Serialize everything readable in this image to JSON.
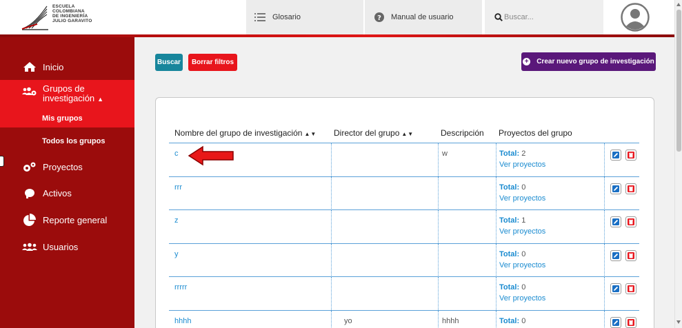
{
  "logo": {
    "line1": "ESCUELA",
    "line2": "COLOMBIANA",
    "line3": "DE INGENIERÍA",
    "line4": "JULIO GARAVITO"
  },
  "header": {
    "glosario": "Glosario",
    "manual": "Manual de usuario",
    "search_placeholder": "Buscar..."
  },
  "sidebar": {
    "inicio": "Inicio",
    "grupos_line1": "Grupos de",
    "grupos_line2": "investigación",
    "mis_grupos": "Mis grupos",
    "todos_grupos": "Todos los grupos",
    "proyectos": "Proyectos",
    "activos": "Activos",
    "reporte": "Reporte general",
    "usuarios": "Usuarios"
  },
  "toolbar": {
    "buscar": "Buscar",
    "borrar": "Borrar filtros",
    "crear": "Crear nuevo grupo de investigación"
  },
  "table": {
    "headers": {
      "nombre": "Nombre del grupo de investigación",
      "director": "Director del grupo",
      "descripcion": "Descripción",
      "proyectos": "Proyectos del grupo"
    },
    "total_label": "Total:",
    "ver_label": "Ver proyectos",
    "rows": [
      {
        "nombre": "c",
        "director": "",
        "descripcion": "w",
        "total": "2"
      },
      {
        "nombre": "rrr",
        "director": "",
        "descripcion": "",
        "total": "0"
      },
      {
        "nombre": "z",
        "director": "",
        "descripcion": "",
        "total": "1"
      },
      {
        "nombre": "y",
        "director": "",
        "descripcion": "",
        "total": "0"
      },
      {
        "nombre": "rrrrr",
        "director": "",
        "descripcion": "",
        "total": "0"
      },
      {
        "nombre": "hhhh",
        "director": "yo",
        "descripcion": "hhhh",
        "total": "0"
      }
    ]
  },
  "colors": {
    "sidebar": "#9b0c0c",
    "active": "#e8151c",
    "purple": "#5a187a",
    "teal": "#17869c",
    "link": "#1a8bd0"
  }
}
